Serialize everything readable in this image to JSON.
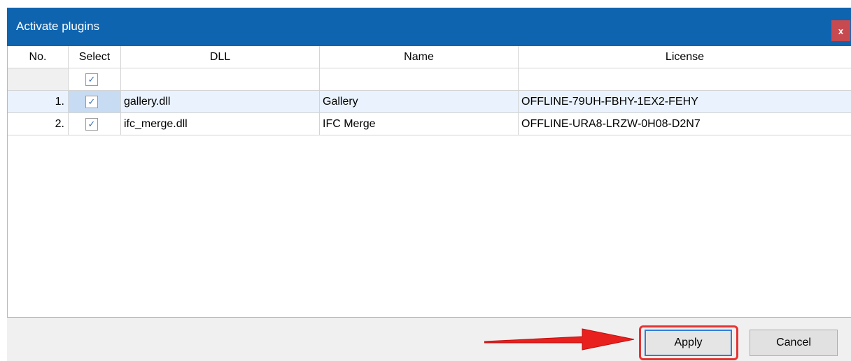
{
  "dialog": {
    "title": "Activate plugins",
    "close_label": "x"
  },
  "table": {
    "columns": [
      "No.",
      "Select",
      "DLL",
      "Name",
      "License"
    ],
    "filter_row": {
      "select_checked": true
    },
    "rows": [
      {
        "no": "1.",
        "selected": true,
        "dll": "gallery.dll",
        "name": "Gallery",
        "license": "OFFLINE-79UH-FBHY-1EX2-FEHY"
      },
      {
        "no": "2.",
        "selected": true,
        "dll": "ifc_merge.dll",
        "name": "IFC Merge",
        "license": "OFFLINE-URA8-LRZW-0H08-D2N7"
      }
    ],
    "check_glyph": "✓"
  },
  "buttons": {
    "apply": "Apply",
    "cancel": "Cancel"
  },
  "colors": {
    "titlebar": "#0f64b0",
    "close_button": "#c64a4f",
    "highlight": "#e53434",
    "annotation_arrow": "#e8201e"
  },
  "annotations": {
    "arrow_icon": "red-arrow-pointing-right"
  }
}
